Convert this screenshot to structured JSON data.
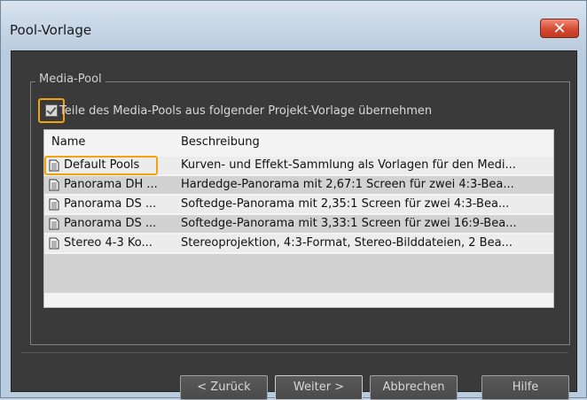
{
  "window": {
    "title": "Pool-Vorlage",
    "close_glyph": "✕"
  },
  "group": {
    "legend": "Media-Pool"
  },
  "checkbox": {
    "label": "Teile des Media-Pools aus folgender Projekt-Vorlage übernehmen",
    "checked": true
  },
  "list": {
    "headers": {
      "name": "Name",
      "description": "Beschreibung"
    },
    "rows": [
      {
        "name": "Default Pools",
        "description": "Kurven- und Effekt-Sammlung als Vorlagen für den Medi..."
      },
      {
        "name": "Panorama DH ...",
        "description": "Hardedge-Panorama mit 2,67:1 Screen für zwei 4:3-Bea..."
      },
      {
        "name": "Panorama DS ...",
        "description": "Softedge-Panorama mit 2,35:1 Screen für zwei 4:3-Bea..."
      },
      {
        "name": "Panorama DS ...",
        "description": "Softedge-Panorama mit 3,33:1 Screen für zwei 16:9-Bea..."
      },
      {
        "name": "Stereo 4-3 Ko...",
        "description": "Stereoprojektion, 4:3-Format, Stereo-Bilddateien, 2 Bea..."
      }
    ],
    "row_icon": "document-icon"
  },
  "buttons": {
    "back": "< Zurück",
    "next": "Weiter >",
    "cancel": "Abbrechen",
    "help": "Hilfe"
  },
  "colors": {
    "highlight": "#f2a20c",
    "close": "#d44a33"
  }
}
